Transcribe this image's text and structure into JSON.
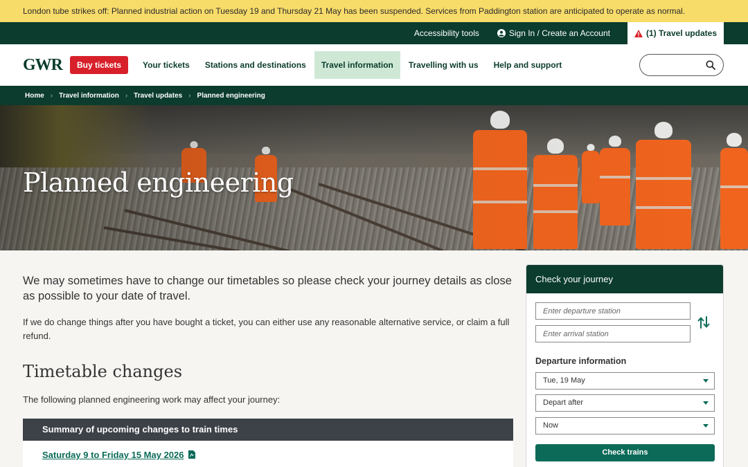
{
  "alert": {
    "text": "London tube strikes off: Planned industrial action on Tuesday 19 and Thursday 21 May has been suspended. Services from Paddington station are anticipated to operate as normal."
  },
  "utility": {
    "accessibility": "Accessibility tools",
    "sign_in": "Sign In / Create an Account",
    "travel_updates": "(1) Travel updates"
  },
  "header": {
    "logo": "GWR",
    "buy_tickets": "Buy tickets",
    "nav": [
      {
        "label": "Your tickets"
      },
      {
        "label": "Stations and destinations"
      },
      {
        "label": "Travel information"
      },
      {
        "label": "Travelling with us"
      },
      {
        "label": "Help and support"
      }
    ],
    "search_placeholder": ""
  },
  "breadcrumb": {
    "items": [
      "Home",
      "Travel information",
      "Travel updates",
      "Planned engineering"
    ],
    "separator": "›"
  },
  "hero": {
    "title": "Planned engineering"
  },
  "main": {
    "intro": "We may sometimes have to change our timetables so please check your journey details as close as possible to your date of travel.",
    "paragraph": "If we do change things after you have bought a ticket, you can either use any reasonable alternative service, or claim a full refund.",
    "heading": "Timetable changes",
    "paragraph2": "The following planned engineering work may affect your journey:",
    "summary_title": "Summary of upcoming changes to train times",
    "summary_link": "Saturday 9 to Friday 15 May 2026"
  },
  "widget": {
    "title": "Check your journey",
    "departure_placeholder": "Enter departure station",
    "arrival_placeholder": "Enter arrival station",
    "departure_info_label": "Departure information",
    "date_value": "Tue, 19 May",
    "time_type_value": "Depart after",
    "time_value": "Now",
    "check_button": "Check trains"
  },
  "colors": {
    "brand_green": "#0b3c2d",
    "accent_green": "#0b6b58",
    "alert_yellow": "#f8dc6a",
    "buy_red": "#d8202a",
    "nav_active_bg": "#cfe8d6"
  },
  "icons": [
    "user-icon",
    "warning-icon",
    "search-icon",
    "swap-icon",
    "pdf-icon",
    "chevron-down-icon"
  ]
}
